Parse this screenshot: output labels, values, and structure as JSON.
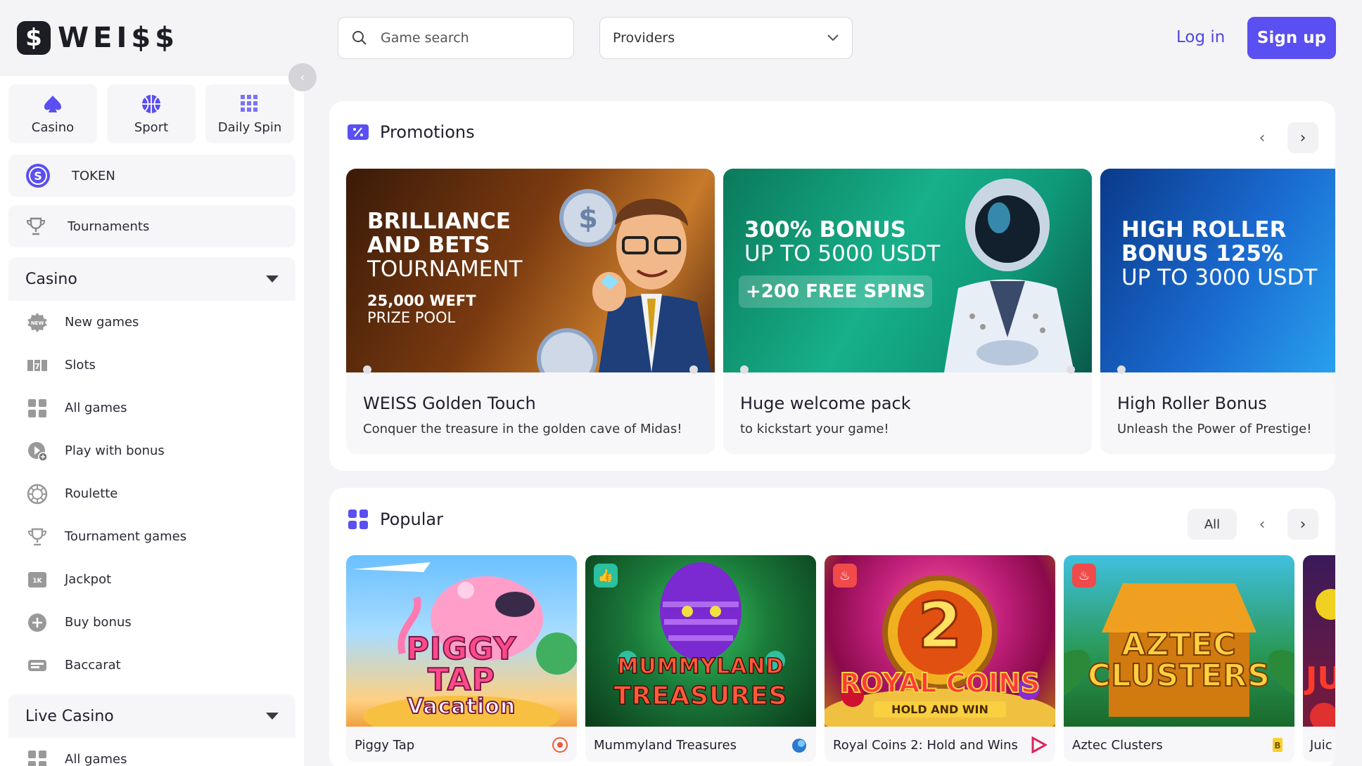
{
  "header": {
    "logo_text": "WEI$$",
    "logo_mark": "$",
    "search_placeholder": "Game search",
    "providers_label": "Providers",
    "login_label": "Log in",
    "signup_label": "Sign up"
  },
  "sidebar": {
    "quick": [
      {
        "label": "Casino",
        "icon": "spade-icon"
      },
      {
        "label": "Sport",
        "icon": "basketball-icon"
      },
      {
        "label": "Daily Spin",
        "icon": "grid-icon"
      }
    ],
    "token_label": "TOKEN",
    "tournaments_label": "Tournaments",
    "casino_section": {
      "title": "Casino",
      "items": [
        {
          "label": "New games",
          "icon": "new-badge-icon"
        },
        {
          "label": "Slots",
          "icon": "slots-icon"
        },
        {
          "label": "All games",
          "icon": "all-games-icon"
        },
        {
          "label": "Play with bonus",
          "icon": "play-bonus-icon"
        },
        {
          "label": "Roulette",
          "icon": "roulette-icon"
        },
        {
          "label": "Tournament games",
          "icon": "trophy-icon"
        },
        {
          "label": "Jackpot",
          "icon": "jackpot-icon"
        },
        {
          "label": "Buy bonus",
          "icon": "plus-circle-icon"
        },
        {
          "label": "Baccarat",
          "icon": "baccarat-icon"
        }
      ]
    },
    "live_section": {
      "title": "Live Casino",
      "items": [
        {
          "label": "All games",
          "icon": "all-games-icon"
        }
      ]
    }
  },
  "promotions": {
    "title": "Promotions",
    "cards": [
      {
        "headline1": "BRILLIANCE",
        "headline2": "AND BETS",
        "headline3": "TOURNAMENT",
        "sub1": "25,000 WEFT",
        "sub2": "PRIZE POOL",
        "name": "WEISS Golden Touch",
        "desc": "Conquer the treasure in the golden cave of Midas!"
      },
      {
        "headline1": "300% BONUS",
        "headline2": "UP TO 5000 USDT",
        "badge": "+200 FREE SPINS",
        "name": "Huge welcome pack",
        "desc": "to kickstart your game!"
      },
      {
        "headline1": "HIGH ROLLER",
        "headline2": "BONUS 125%",
        "headline3": "UP TO 3000 USDT",
        "name": "High Roller Bonus",
        "desc": "Unleash the Power of Prestige!"
      }
    ]
  },
  "popular": {
    "title": "Popular",
    "all_label": "All",
    "games": [
      {
        "name": "Piggy Tap",
        "art1": "PIGGY",
        "art2": "TAP",
        "art3": "Vacation"
      },
      {
        "name": "Mummyland Treasures",
        "art1": "MUMMYLAND",
        "art2": "TREASURES"
      },
      {
        "name": "Royal Coins 2: Hold and Wins",
        "art1": "2",
        "art2": "ROYAL COINS",
        "art3": "HOLD AND WIN"
      },
      {
        "name": "Aztec Clusters",
        "art1": "AZTEC",
        "art2": "CLUSTERS"
      },
      {
        "name": "Juic",
        "art1": "JU"
      }
    ]
  }
}
